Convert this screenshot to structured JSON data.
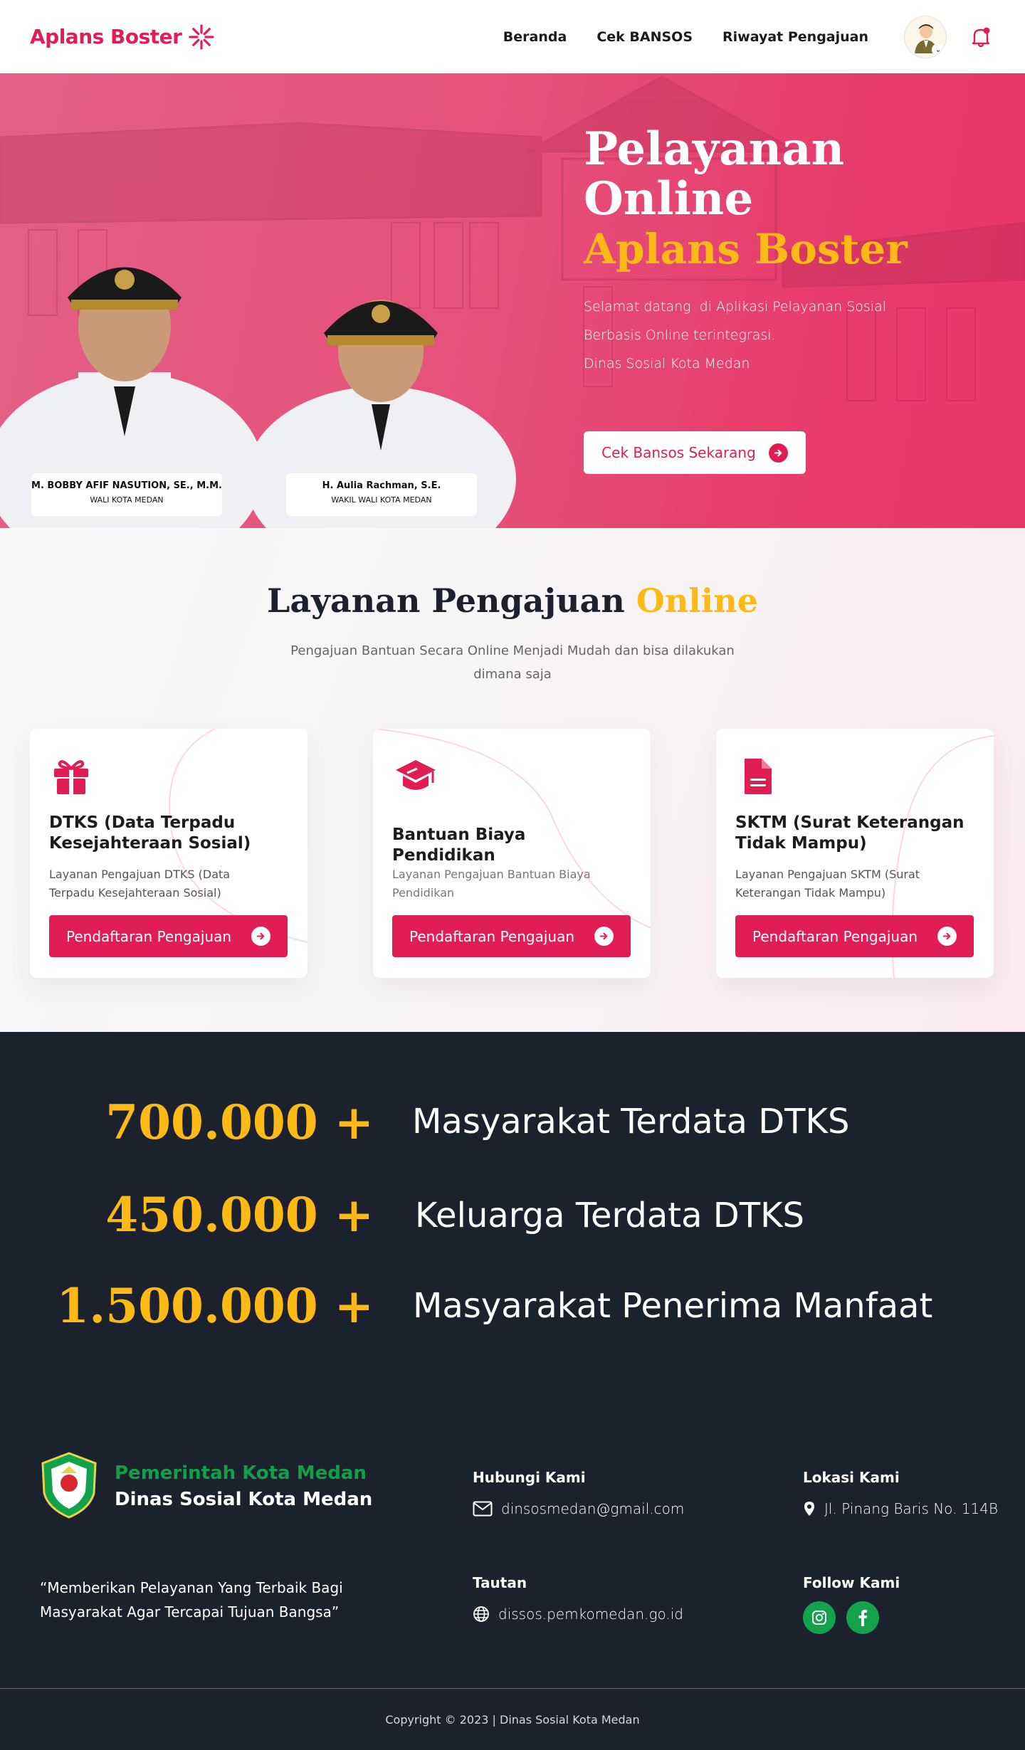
{
  "brand": {
    "name": "Aplans Boster",
    "accent": "#e01e55"
  },
  "nav": {
    "links": [
      "Beranda",
      "Cek BANSOS",
      "Riwayat Pengajuan"
    ]
  },
  "hero": {
    "title_line1": "Pelayanan",
    "title_line2": "Online",
    "title_line3": "Aplans Boster",
    "desc_line1": "Selamat datang  di Aplikasi Pelayanan Sosial",
    "desc_line2": "Berbasis Online terintegrasi.",
    "desc_line3": "Dinas Sosial Kota Medan",
    "cta": "Cek Bansos Sekarang",
    "officials": [
      {
        "name": "M. BOBBY AFIF NASUTION, SE., M.M.",
        "role": "WALI KOTA MEDAN"
      },
      {
        "name": "H. Aulia Rachman, S.E.",
        "role": "WAKIL WALI KOTA MEDAN"
      }
    ]
  },
  "services": {
    "title_main": "Layanan Pengajuan",
    "title_accent": "Online",
    "subtitle": "Pengajuan Bantuan Secara Online Menjadi Mudah dan bisa dilakukan dimana saja",
    "cards": [
      {
        "icon": "gift-icon",
        "title": "DTKS (Data Terpadu Kesejahteraan Sosial)",
        "desc": "Layanan Pengajuan DTKS (Data Terpadu Kesejahteraan Sosial)",
        "button": "Pendaftaran Pengajuan"
      },
      {
        "icon": "graduation-cap-icon",
        "title": "Bantuan Biaya Pendidikan",
        "desc": "Layanan Pengajuan Bantuan Biaya Pendidikan",
        "button": "Pendaftaran Pengajuan"
      },
      {
        "icon": "document-icon",
        "title": "SKTM (Surat Keterangan Tidak Mampu)",
        "desc": "Layanan Pengajuan SKTM (Surat Keterangan Tidak Mampu)",
        "button": "Pendaftaran Pengajuan"
      }
    ]
  },
  "stats": [
    {
      "value": "700.000 +",
      "label": "Masyarakat Terdata DTKS"
    },
    {
      "value": "450.000 +",
      "label": "Keluarga Terdata DTKS"
    },
    {
      "value": "1.500.000 +",
      "label": "Masyarakat Penerima Manfaat"
    }
  ],
  "footer": {
    "org_line1": "Pemerintah Kota Medan",
    "org_line2": "Dinas Sosial Kota Medan",
    "quote": "“Memberikan Pelayanan Yang Terbaik Bagi Masyarakat Agar Tercapai Tujuan Bangsa”",
    "contact_heading": "Hubungi Kami",
    "email": "dinsosmedan@gmail.com",
    "location_heading": "Lokasi Kami",
    "address": "Jl. Pinang Baris No. 114B",
    "links_heading": "Tautan",
    "website": "dissos.pemkomedan.go.id",
    "follow_heading": "Follow Kami",
    "copyright": "Copyright © 2023 | Dinas Sosial Kota Medan"
  },
  "colors": {
    "accent": "#e01e55",
    "gold": "#fdb916",
    "dark": "#1c212e",
    "green": "#10a04a"
  }
}
